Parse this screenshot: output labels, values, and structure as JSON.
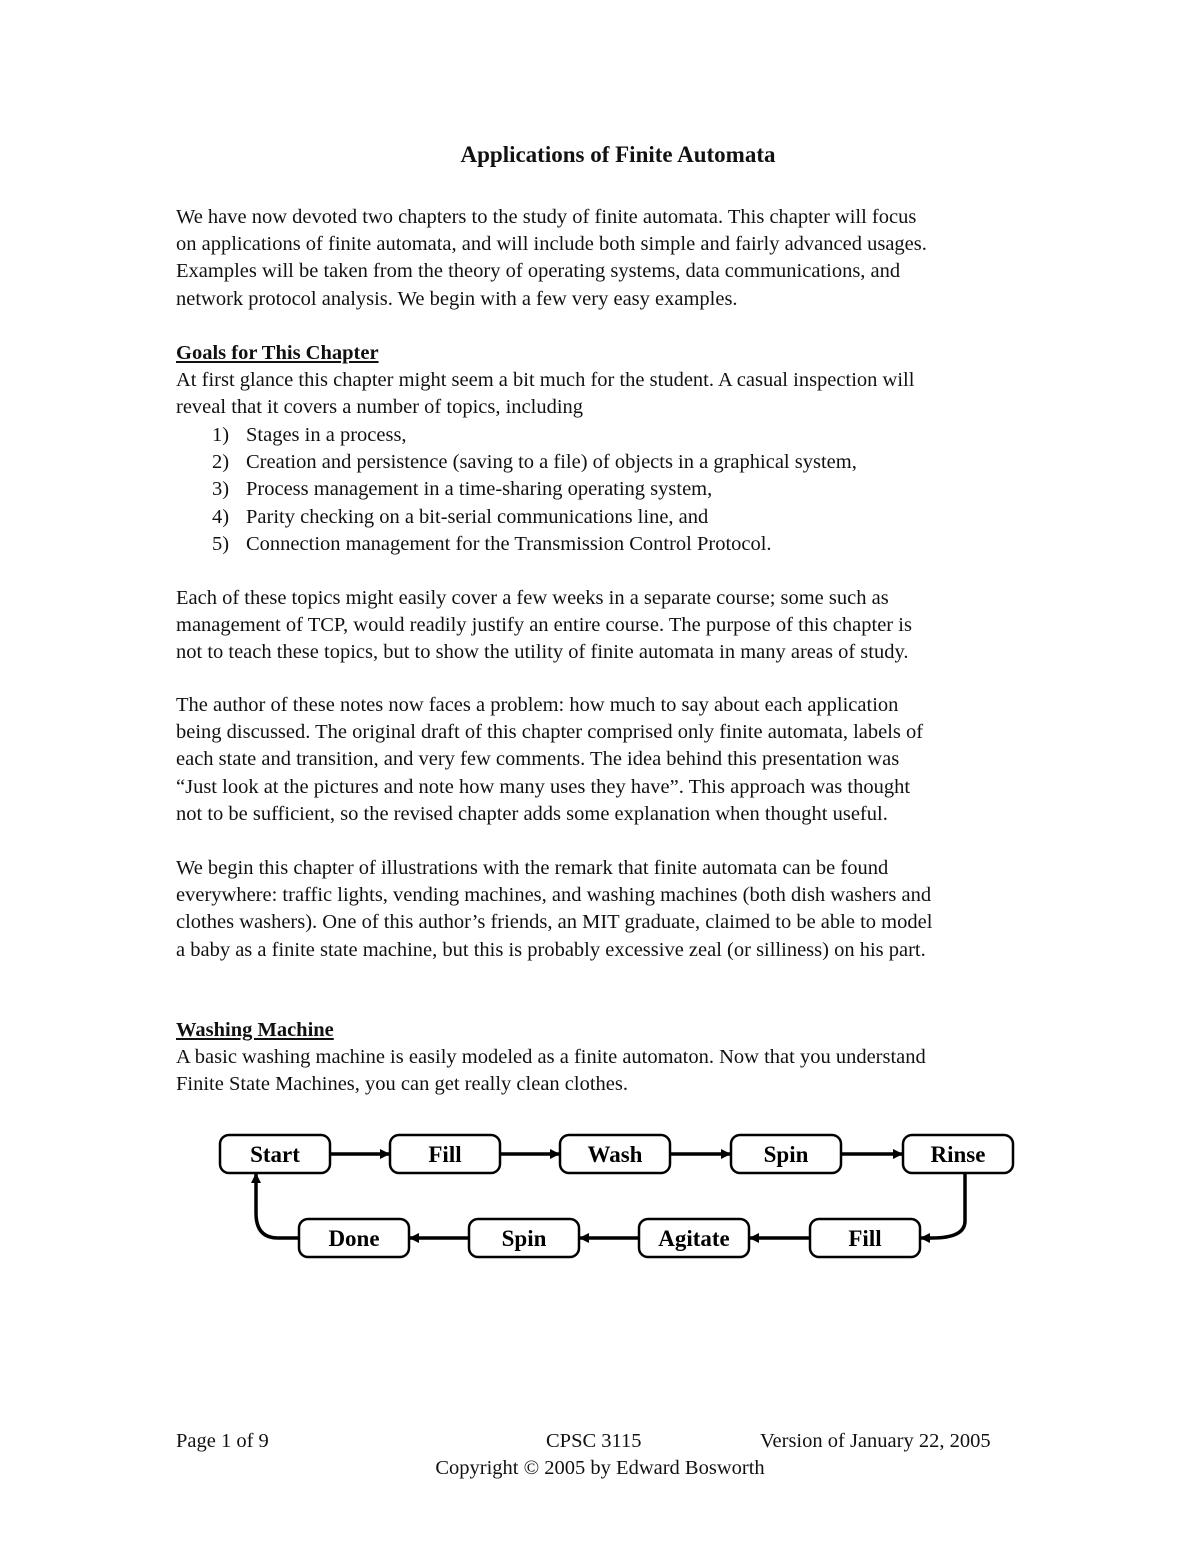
{
  "document": {
    "title": "Applications of Finite Automata",
    "intro": "We have now devoted two chapters to the study of finite automata.  This chapter will focus on applications of finite automata, and will include both simple and fairly advanced usages. Examples will be taken from the theory of operating systems, data communications, and network protocol analysis.  We begin with a few very easy examples.",
    "intro_lines": [
      "We have now devoted two chapters to the study of finite automata.  This chapter will focus",
      "on applications of finite automata, and will include both simple and fairly advanced usages.",
      "Examples will be taken from the theory of operating systems, data communications, and",
      "network protocol analysis.  We begin with a few very easy examples."
    ],
    "goals": {
      "heading": "Goals for This Chapter",
      "lines": [
        "At first glance this chapter might seem a bit much for the student.  A casual inspection will",
        "reveal that it covers a number of topics, including"
      ],
      "items": [
        {
          "num": "1)",
          "text": "Stages in a process,"
        },
        {
          "num": "2)",
          "text": "Creation and persistence (saving to a file) of objects in a graphical system,"
        },
        {
          "num": "3)",
          "text": "Process management in a time-sharing operating system,"
        },
        {
          "num": "4)",
          "text": "Parity checking on a bit-serial communications line, and"
        },
        {
          "num": "5)",
          "text": "Connection management for the Transmission Control Protocol."
        }
      ]
    },
    "para_topics": [
      "Each of these topics might easily cover a few weeks in a separate course; some such as",
      "management of TCP, would readily justify an entire course.  The purpose of this chapter is",
      "not to teach these topics, but to show the utility of finite automata in many areas of study."
    ],
    "para_author": [
      "The author of these notes now faces a problem: how much to say about each application",
      "being discussed.  The original draft of this chapter comprised only finite automata, labels of",
      "each state and transition, and very few comments.  The idea behind this presentation was",
      "“Just look at the pictures and note how many uses they have”.  This approach was thought",
      "not to be sufficient, so the revised chapter adds some explanation when thought useful."
    ],
    "para_everywhere": [
      "We begin this chapter of illustrations with the remark that finite automata can be found",
      "everywhere: traffic lights, vending machines, and washing machines (both dish washers and",
      "clothes washers).  One of this author’s friends, an MIT graduate, claimed to be able to model",
      "a baby as a finite state machine, but this is probably excessive zeal (or silliness) on his part."
    ],
    "washing": {
      "heading": "Washing Machine",
      "lines": [
        "A basic washing machine is easily modeled as a finite automaton.  Now that you understand",
        "Finite State Machines, you can get really clean clothes."
      ]
    },
    "diagram": {
      "top_row": [
        "Start",
        "Fill",
        "Wash",
        "Spin",
        "Rinse"
      ],
      "bottom_row": [
        "Done",
        "Spin",
        "Agitate",
        "Fill"
      ],
      "sequence": [
        "Start",
        "Fill",
        "Wash",
        "Spin",
        "Rinse",
        "Fill",
        "Agitate",
        "Spin",
        "Done",
        "Start"
      ]
    },
    "footer": {
      "page": "Page 1 of 9",
      "course": "CPSC 3115",
      "version": "Version of January 22, 2005",
      "copyright": "Copyright © 2005 by Edward Bosworth"
    }
  }
}
